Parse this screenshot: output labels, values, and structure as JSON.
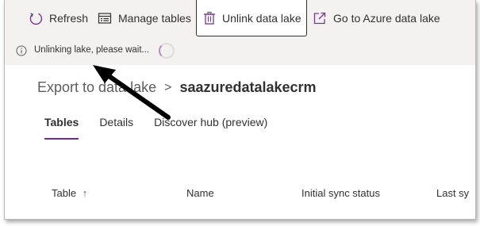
{
  "commands": {
    "refresh": "Refresh",
    "manage_tables": "Manage tables",
    "unlink": "Unlink data lake",
    "go_to_azure": "Go to Azure data lake"
  },
  "status": {
    "message": "Unlinking lake, please wait..."
  },
  "breadcrumb": {
    "parent": "Export to data lake",
    "separator": ">",
    "current": "saazuredatalakecrm"
  },
  "tabs": [
    {
      "label": "Tables",
      "active": true
    },
    {
      "label": "Details",
      "active": false
    },
    {
      "label": "Discover hub (preview)",
      "active": false
    }
  ],
  "table": {
    "columns": [
      {
        "label": "Table",
        "sort": "↑"
      },
      {
        "label": "Name"
      },
      {
        "label": "Initial sync status"
      },
      {
        "label": "Last sy"
      }
    ]
  },
  "colors": {
    "accent": "#6b2f7f",
    "commandbar_bg": "#f3f2f1",
    "annotation_arrow": "#000000"
  },
  "icons": {
    "refresh": "refresh-icon",
    "manage_tables": "table-icon",
    "unlink": "trash-icon",
    "go_to_azure": "external-link-icon",
    "status": "info-icon",
    "loading": "spinner-icon"
  }
}
